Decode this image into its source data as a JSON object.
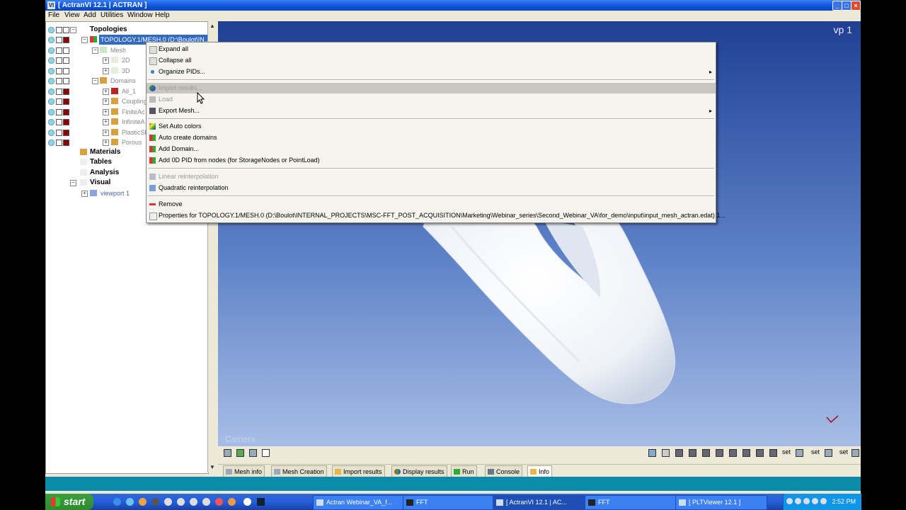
{
  "window": {
    "title": "ActranVI 12.1 | ACTRAN",
    "icon": "VI"
  },
  "menu": [
    "File",
    "View",
    "Add",
    "Utilities",
    "Window",
    "Help"
  ],
  "tree": {
    "topologies": "Topologies",
    "topology1": "TOPOLOGY.1/MESH.0 (D:\\Boulot\\IN...",
    "mesh": "Mesh",
    "d2": "2D",
    "d3": "3D",
    "domains": "Domains",
    "all1": "All_1",
    "coupling": "Coupling",
    "finiteac": "FiniteAc",
    "infiniteac": "InfiniteA",
    "plasticsh": "PlasticSh",
    "porous": "Porous",
    "materials": "Materials",
    "tables": "Tables",
    "analysis": "Analysis",
    "visual": "Visual",
    "viewport1": "viewport 1"
  },
  "context_menu": {
    "expand_all": "Expand all",
    "collapse_all": "Collapse all",
    "organize_pids": "Organize PIDs...",
    "import_results": "Import results...",
    "load": "Load",
    "export_mesh": "Export Mesh...",
    "set_auto_colors": "Set Auto colors",
    "auto_create_domains": "Auto create domains",
    "add_domain": "Add Domain...",
    "add_0d_pid": "Add 0D PID from nodes (for StorageNodes or PointLoad)",
    "linear_reinterp": "Linear reinterpolation",
    "quadratic_reinterp": "Quadratic reinterpolation",
    "remove": "Remove",
    "properties": "Properties for TOPOLOGY.1/MESH.0 (D:\\Boulot\\INTERNAL_PROJECTS\\MSC-FFT_POST_ACQUISITION\\Marketing\\Webinar_series\\Second_Webinar_VA\\for_demo\\input\\input_mesh_actran.edat) 1...",
    "submenu_arrow": "▸"
  },
  "viewport": {
    "label": "vp 1",
    "camera": "Camera"
  },
  "toolbar": {
    "set1": "set",
    "set2": "set",
    "set3": "set"
  },
  "tabs": [
    "Mesh info",
    "Mesh Creation",
    "Import results",
    "Display results",
    "Run",
    "Console",
    "Info"
  ],
  "taskbar": {
    "start": "start",
    "tasks": [
      "Actran Webinar_VA_f...",
      "FFT",
      "[ ActranVI 12.1 | AC...",
      "FFT",
      "[ PLTViewer 12.1 ]"
    ],
    "clock": "2:52 PM"
  },
  "colors": {
    "title_bar": "#0a52d8",
    "selection": "#316ac5",
    "viewport_top": "#203f94",
    "viewport_bottom": "#a7bde6",
    "status_bar": "#0d8ca9",
    "taskbar": "#245edb"
  }
}
